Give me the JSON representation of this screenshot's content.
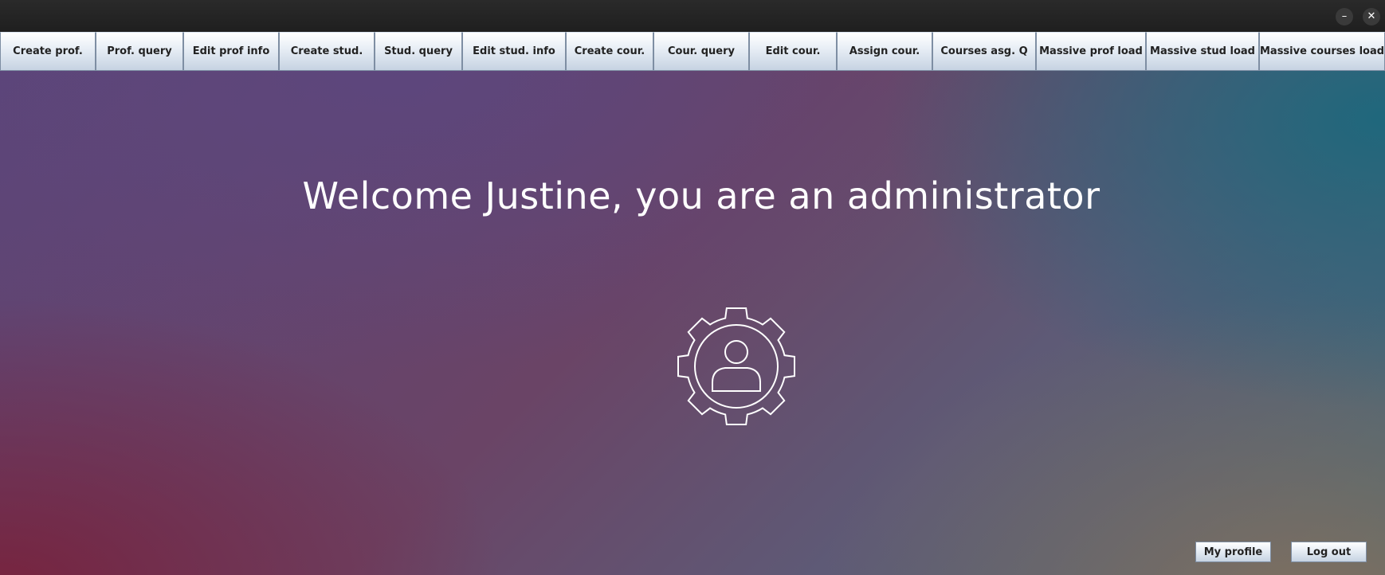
{
  "window": {
    "minimize_label": "–",
    "close_label": "✕"
  },
  "toolbar": {
    "items": [
      {
        "label": "Create prof."
      },
      {
        "label": "Prof. query"
      },
      {
        "label": "Edit prof info"
      },
      {
        "label": "Create stud."
      },
      {
        "label": "Stud. query"
      },
      {
        "label": "Edit stud. info"
      },
      {
        "label": "Create cour."
      },
      {
        "label": "Cour. query"
      },
      {
        "label": "Edit cour."
      },
      {
        "label": "Assign cour."
      },
      {
        "label": "Courses asg. Q"
      },
      {
        "label": "Massive prof load"
      },
      {
        "label": "Massive stud load"
      },
      {
        "label": "Massive courses load"
      }
    ]
  },
  "main": {
    "welcome_text": "Welcome Justine, you are an administrator",
    "icon": "admin-gear-user-icon"
  },
  "footer": {
    "my_profile_label": "My profile",
    "log_out_label": "Log out"
  },
  "colors": {
    "text_light": "#ffffff",
    "button_border": "#7e8ea3",
    "titlebar": "#1f1f1f"
  }
}
